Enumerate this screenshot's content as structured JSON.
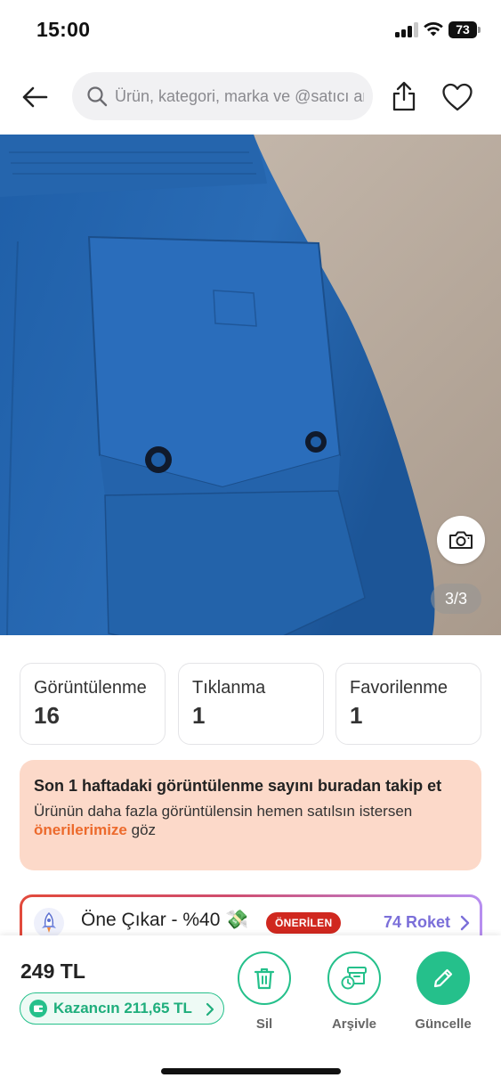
{
  "status_bar": {
    "time": "15:00",
    "battery": "73"
  },
  "top_bar": {
    "search_placeholder": "Ürün, kategori, marka ve @satıcı ara",
    "icons": [
      "back-arrow-icon",
      "search-icon",
      "share-icon",
      "heart-icon"
    ]
  },
  "gallery": {
    "counter": "3/3",
    "camera_icon": "camera-icon"
  },
  "stats": [
    {
      "label": "Görüntülenme",
      "value": "16"
    },
    {
      "label": "Tıklanma",
      "value": "1"
    },
    {
      "label": "Favorilenme",
      "value": "1"
    }
  ],
  "tip": {
    "title": "Son 1 haftadaki görüntülenme sayını buradan takip et",
    "body_prefix": "Ürünün daha fazla görüntülensin hemen satılsın istersen",
    "link": "önerilerimize",
    "body_suffix": "göz"
  },
  "promo": {
    "title": "Öne Çıkar - %40 💸",
    "badge": "ÖNERİLEN",
    "rocket": "74 Roket"
  },
  "bottom_bar": {
    "price": "249 TL",
    "earnings": "Kazancın 211,65 TL",
    "actions": [
      {
        "label": "Sil",
        "icon": "trash-icon"
      },
      {
        "label": "Arşivle",
        "icon": "archive-icon"
      },
      {
        "label": "Güncelle",
        "icon": "pencil-icon"
      }
    ]
  },
  "colors": {
    "accent_green": "#25c08b",
    "tip_background": "#fcd9c9",
    "tip_link": "#ec6a2c",
    "badge_red": "#d0281f",
    "rocket_purple": "#7b6fd9"
  }
}
